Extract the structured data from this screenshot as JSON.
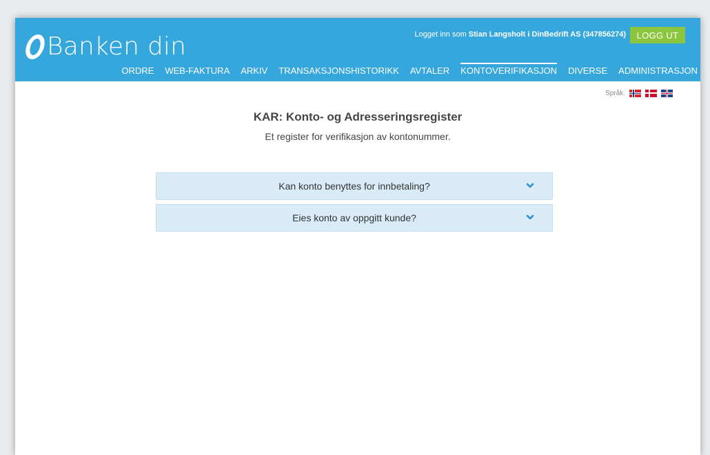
{
  "header": {
    "brand": "Banken din",
    "user_prefix": "Logget inn som",
    "user_info": "Stian Langsholt i DinBedrift AS (347856274)",
    "logout_label": "LOGG UT"
  },
  "nav": {
    "items": [
      {
        "label": "ORDRE"
      },
      {
        "label": "WEB-FAKTURA"
      },
      {
        "label": "ARKIV"
      },
      {
        "label": "TRANSAKSJONSHISTORIKK"
      },
      {
        "label": "AVTALER"
      },
      {
        "label": "KONTOVERIFIKASJON",
        "active": true
      },
      {
        "label": "DIVERSE"
      },
      {
        "label": "ADMINISTRASJON"
      }
    ]
  },
  "language": {
    "label": "Språk:",
    "flags": [
      "norway-flag-icon",
      "denmark-flag-icon",
      "uk-flag-icon"
    ]
  },
  "main": {
    "title": "KAR: Konto- og Adresseringsregister",
    "subtitle": "Et register for verifikasjon av kontonummer.",
    "accordions": [
      {
        "label": "Kan konto benyttes for innbetaling?",
        "icon": "chevron-down-icon"
      },
      {
        "label": "Eies konto av oppgitt kunde?",
        "icon": "chevron-down-icon"
      }
    ]
  },
  "colors": {
    "header_bg": "#35a7dd",
    "logout_bg": "#8cc63f",
    "accordion_bg": "#d9ebf6",
    "chevron": "#2a8fd0"
  }
}
